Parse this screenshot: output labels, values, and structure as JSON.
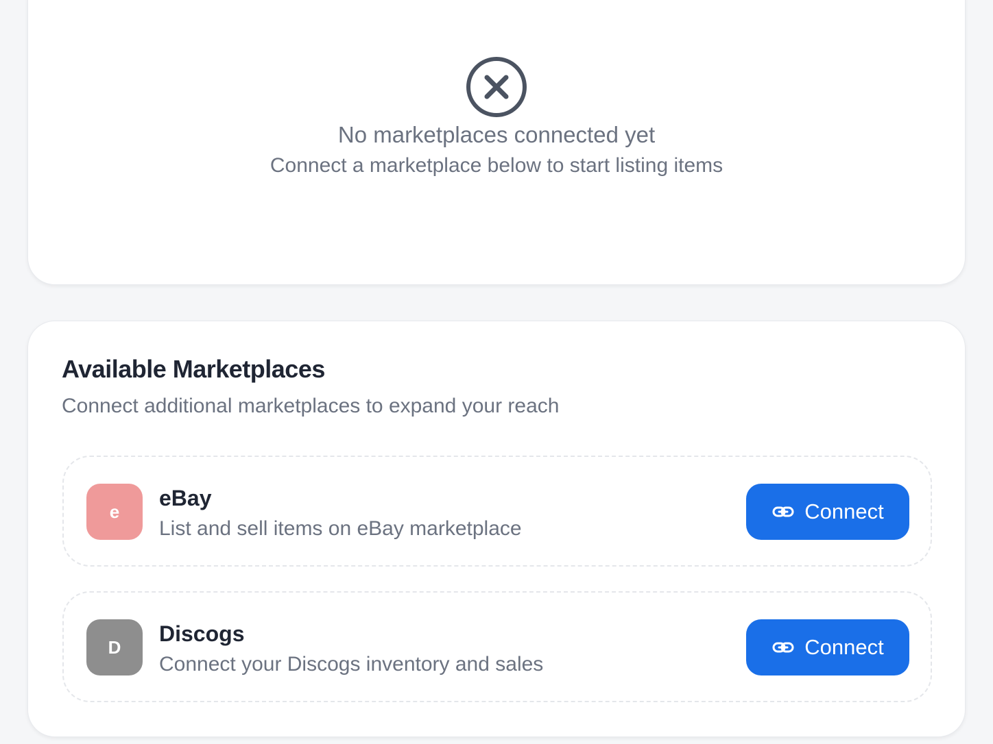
{
  "empty_state": {
    "icon": "x-circle-icon",
    "title": "No marketplaces connected yet",
    "subtitle": "Connect a marketplace below to start listing items"
  },
  "available": {
    "title": "Available Marketplaces",
    "subtitle": "Connect additional marketplaces to expand your reach",
    "items": [
      {
        "logo_letter": "e",
        "logo_color": "#ef9a9a",
        "name": "eBay",
        "description": "List and sell items on eBay marketplace",
        "button_label": "Connect",
        "button_icon": "link-icon"
      },
      {
        "logo_letter": "D",
        "logo_color": "#8e8e8e",
        "name": "Discogs",
        "description": "Connect your Discogs inventory and sales",
        "button_label": "Connect",
        "button_icon": "link-icon"
      }
    ]
  },
  "colors": {
    "accent": "#1a6fe8",
    "muted_text": "#6b7280",
    "heading_text": "#1f2533",
    "icon_gray": "#4b5361"
  }
}
